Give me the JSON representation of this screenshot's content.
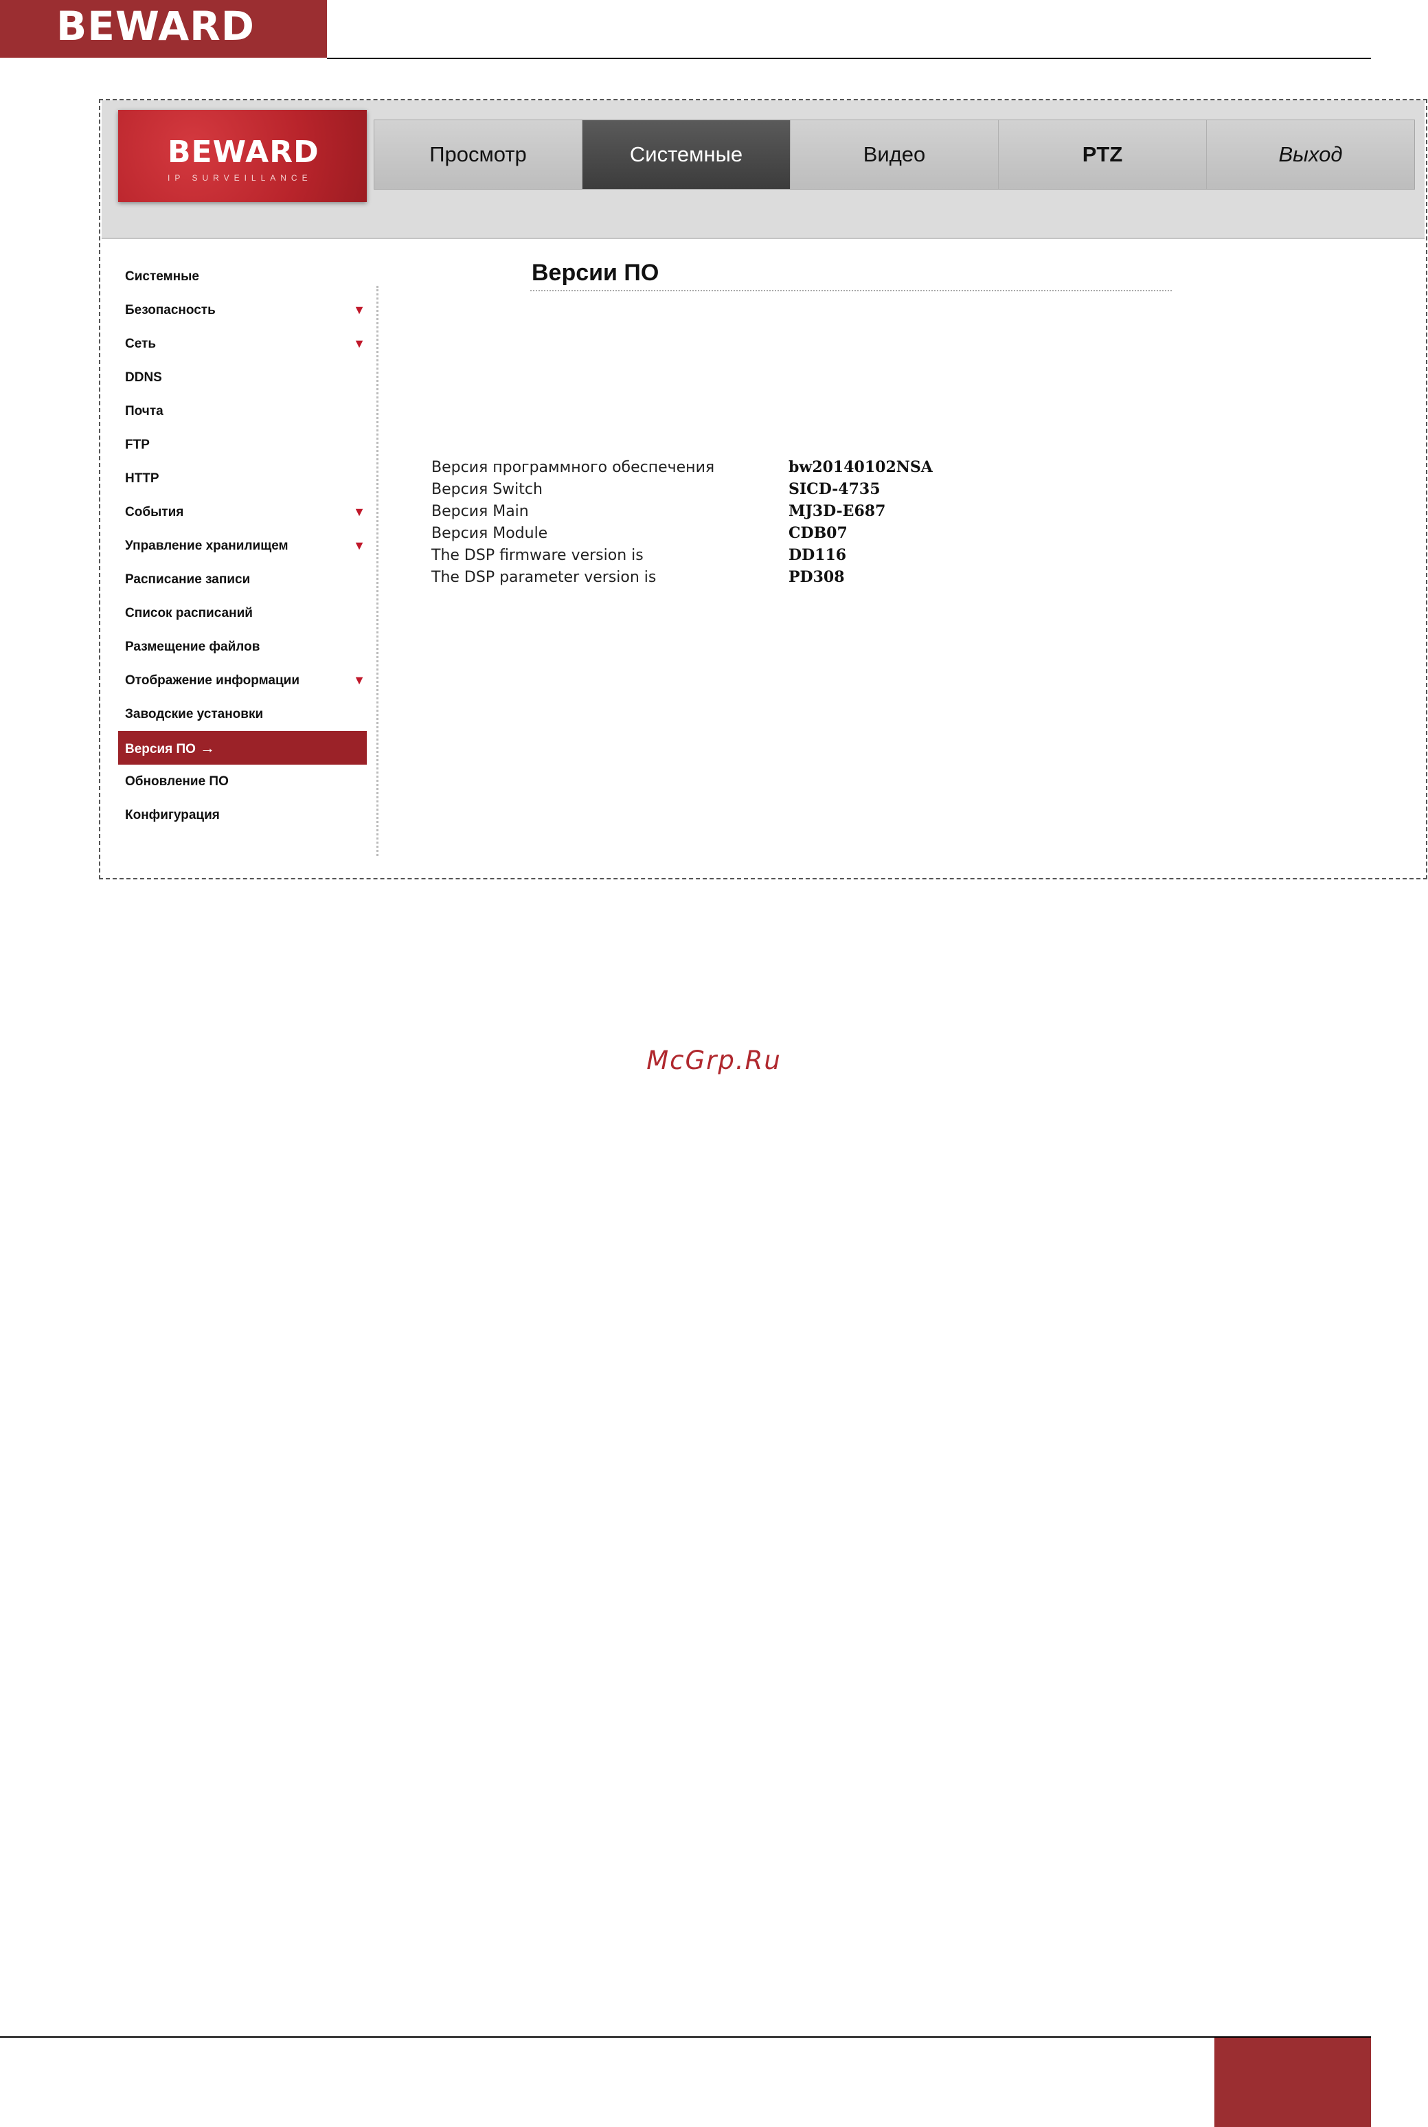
{
  "doc_header": {
    "brand": "BEWARD"
  },
  "app": {
    "brand_name": "BEWARD",
    "brand_sub": "IP SURVEILLANCE",
    "tabs": [
      {
        "label": "Просмотр"
      },
      {
        "label": "Системные"
      },
      {
        "label": "Видео"
      },
      {
        "label": "PTZ"
      },
      {
        "label": "Выход"
      }
    ]
  },
  "sidebar": {
    "items": [
      {
        "label": "Системные"
      },
      {
        "label": "Безопасность",
        "expand": "▼"
      },
      {
        "label": "Сеть",
        "expand": "▼"
      },
      {
        "label": "DDNS"
      },
      {
        "label": "Почта"
      },
      {
        "label": "FTP"
      },
      {
        "label": "HTTP"
      },
      {
        "label": "События",
        "expand": "▼"
      },
      {
        "label": "Управление хранилищем",
        "expand": "▼"
      },
      {
        "label": "Расписание записи"
      },
      {
        "label": "Список расписаний"
      },
      {
        "label": "Размещение файлов"
      },
      {
        "label": "Отображение информации",
        "expand": "▼"
      },
      {
        "label": "Заводские установки"
      },
      {
        "label": "Версия ПО",
        "arrow": "→"
      },
      {
        "label": "Обновление ПО"
      },
      {
        "label": "Конфигурация"
      }
    ]
  },
  "main": {
    "title": "Версии ПО",
    "rows": [
      {
        "label": "Версия программного обеспечения",
        "value": "bw20140102NSA"
      },
      {
        "label": "Версия Switch",
        "value": "SICD-4735"
      },
      {
        "label": "Версия Main",
        "value": "MJ3D-E687"
      },
      {
        "label": "Версия Module",
        "value": "CDB07"
      },
      {
        "label": "The DSP firmware version is",
        "value": "DD116"
      },
      {
        "label": "The DSP parameter version is",
        "value": "PD308"
      }
    ]
  },
  "watermark": "McGrp.Ru",
  "colors": {
    "brand_red": "#9b2e31",
    "active_tab": "#4a4a4a",
    "active_side": "#9b2228",
    "expand_arrow": "#c0182a"
  }
}
